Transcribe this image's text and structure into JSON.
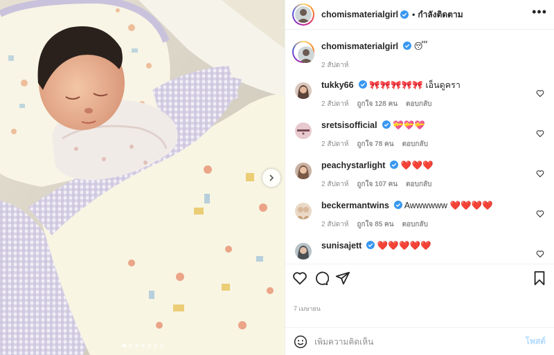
{
  "header": {
    "username": "chomismaterialgirl",
    "separator": "•",
    "follow_label": "กำลังติดตาม",
    "more_label": "•••"
  },
  "caption": {
    "username": "chomismaterialgirl",
    "text": "😴",
    "time": "2 สัปดาห์"
  },
  "comments": [
    {
      "username": "tukky66",
      "text": "🎀🎀🎀🎀🎀 เอ็นดูครา",
      "time": "2 สัปดาห์",
      "likes": "ถูกใจ 128 คน",
      "reply": "ตอบกลับ",
      "avatar": "woman-avatar",
      "av_color": "#5b4238"
    },
    {
      "username": "sretsisofficial",
      "text": "💝💝💝",
      "time": "2 สัปดาห์",
      "likes": "ถูกใจ 78 คน",
      "reply": "ตอบกลับ",
      "avatar": "brand-avatar",
      "av_color": "#e8c9cf",
      "av_text": "SRETSIS"
    },
    {
      "username": "peachystarlight",
      "text": "❤️❤️❤️",
      "time": "2 สัปดาห์",
      "likes": "ถูกใจ 107 คน",
      "reply": "ตอบกลับ",
      "avatar": "woman-avatar",
      "av_color": "#7a5a47"
    },
    {
      "username": "beckermantwins",
      "text": "Awwwwww ❤️❤️❤️❤️",
      "time": "2 สัปดาห์",
      "likes": "ถูกใจ 85 คน",
      "reply": "ตอบกลับ",
      "avatar": "twins-avatar",
      "av_color": "#d9b99b"
    },
    {
      "username": "sunisajett",
      "text": "❤️❤️❤️❤️❤️",
      "time": "",
      "likes": "",
      "reply": "",
      "avatar": "woman-avatar",
      "av_color": "#b7c2c7"
    }
  ],
  "footer": {
    "date": "7 เมษายน",
    "comment_placeholder": "เพิ่มความคิดเห็น",
    "post_label": "โพสต์"
  },
  "carousel": {
    "total": 7,
    "active": 0
  },
  "colors": {
    "verified": "#3897f0",
    "link": "#b3dbff",
    "muted": "#8e8e8e",
    "border": "#efefef"
  }
}
